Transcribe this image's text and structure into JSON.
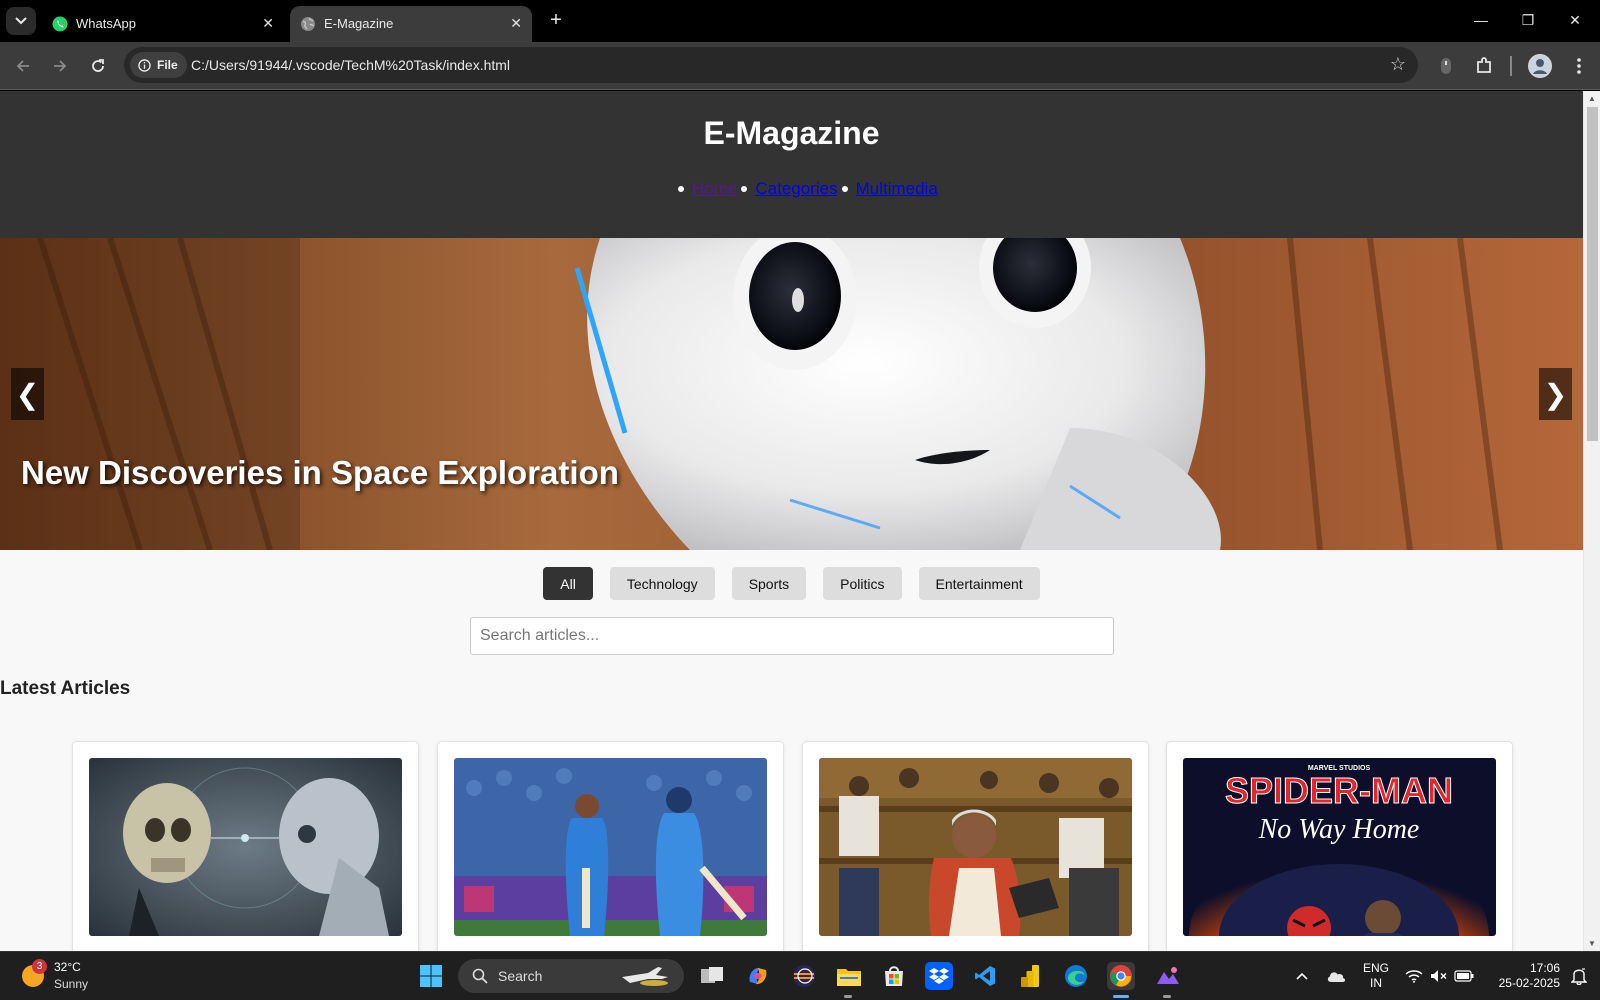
{
  "browser": {
    "tabs": [
      {
        "title": "WhatsApp",
        "close": "✕",
        "icon": "whatsapp-icon"
      },
      {
        "title": "E-Magazine",
        "close": "✕",
        "icon": "globe-icon"
      }
    ],
    "new_tab": "+",
    "window_controls": {
      "minimize": "—",
      "restore": "❐",
      "close": "✕"
    },
    "address": {
      "chip": "File",
      "url": "C:/Users/91944/.vscode/TechM%20Task/index.html"
    },
    "bookmark_icon": "☆"
  },
  "site": {
    "title": "E-Magazine",
    "nav": [
      {
        "label": "Home",
        "state": "visited"
      },
      {
        "label": "Categories",
        "state": "link"
      },
      {
        "label": "Multimedia",
        "state": "link"
      }
    ],
    "hero": {
      "title": "New Discoveries in Space Exploration",
      "prev": "❮",
      "next": "❯"
    },
    "filters": [
      "All",
      "Technology",
      "Sports",
      "Politics",
      "Entertainment"
    ],
    "active_filter": "All",
    "search_placeholder": "Search articles...",
    "section_title": "Latest Articles",
    "cards": [
      {
        "image": "ai-skull-robot-image"
      },
      {
        "image": "cricket-players-image"
      },
      {
        "image": "parliament-speech-image"
      },
      {
        "image": "spiderman-poster-image",
        "poster_brand": "MARVEL STUDIOS",
        "poster_title": "SPIDER-MAN",
        "poster_subtitle": "No Way Home"
      }
    ]
  },
  "taskbar": {
    "weather": {
      "badge": "3",
      "temp": "32°C",
      "condition": "Sunny"
    },
    "search_label": "Search",
    "language": {
      "line1": "ENG",
      "line2": "IN"
    },
    "clock": {
      "time": "17:06",
      "date": "25-02-2025"
    }
  },
  "colors": {
    "header_bg": "#333333",
    "active_filter_bg": "#333333",
    "filter_bg": "#dddddd",
    "page_bg": "#f8f8f8"
  }
}
